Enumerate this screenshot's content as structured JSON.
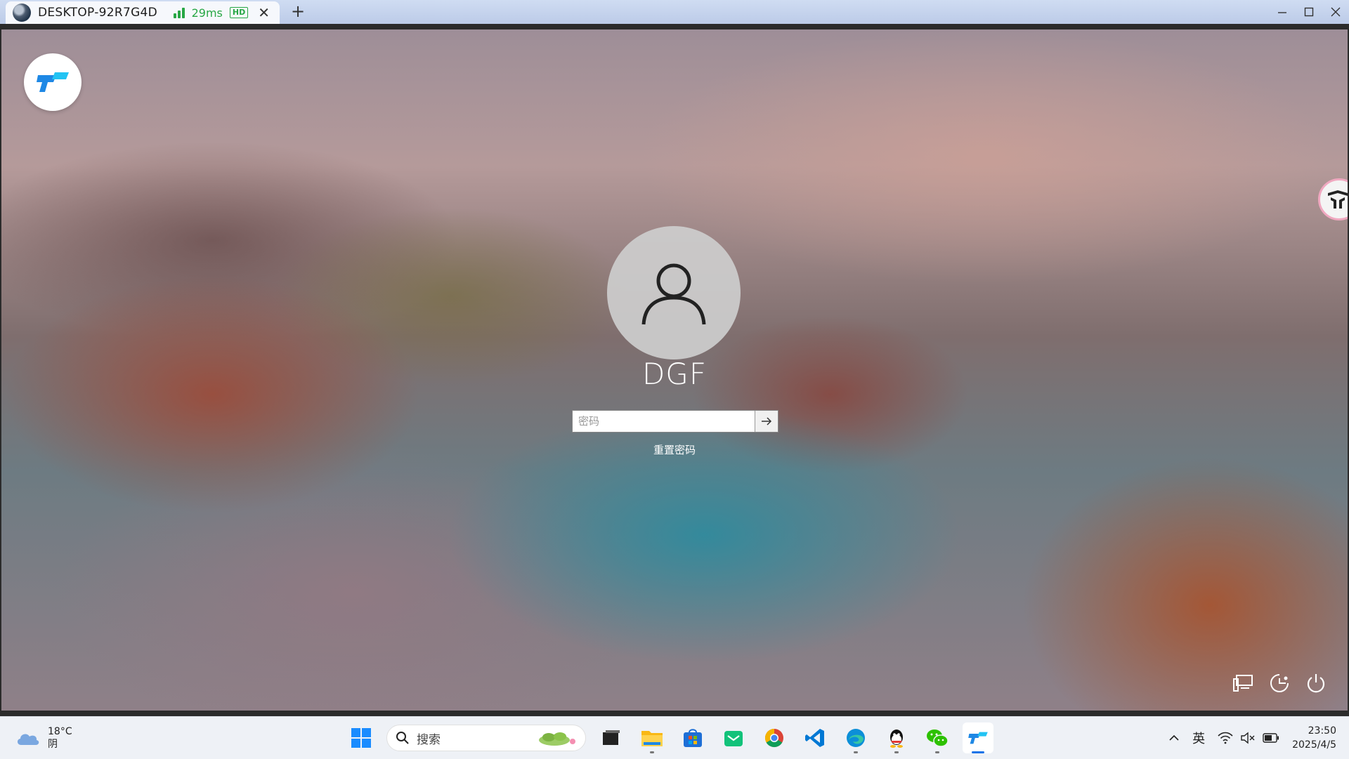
{
  "window": {
    "tab_title": "DESKTOP-92R7G4D",
    "latency": "29ms",
    "quality_badge": "HD",
    "new_tab": "+",
    "close_tab": "✕"
  },
  "lock_screen": {
    "username": "DGF",
    "password_placeholder": "密码",
    "password_value": "",
    "reset_password_link": "重置密码",
    "corner_icons": [
      "network-icon",
      "accessibility-icon",
      "power-icon"
    ]
  },
  "taskbar": {
    "weather": {
      "temp": "18°C",
      "condition": "阴"
    },
    "search_placeholder": "搜索",
    "apps": [
      "windows-start",
      "search",
      "task-view",
      "file-explorer",
      "microsoft-store",
      "email",
      "chrome",
      "vscode",
      "edge",
      "qq",
      "wechat",
      "todesk"
    ],
    "tray": {
      "language": "英",
      "time": "23:50",
      "date": "2025/4/5"
    }
  },
  "colors": {
    "signal_green": "#28a745",
    "accent_blue": "#1a73e8",
    "app_logo_blue": "#1e88e5"
  }
}
